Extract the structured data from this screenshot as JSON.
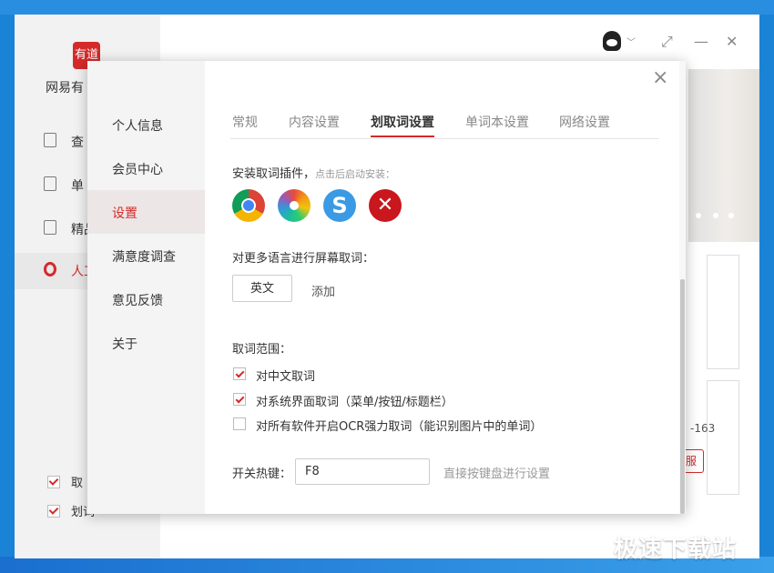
{
  "app": {
    "logo_text": "有道",
    "name": "网易有",
    "nav": [
      {
        "label": "查",
        "icon": "lookup-icon"
      },
      {
        "label": "单",
        "icon": "wordbook-icon"
      },
      {
        "label": "精品",
        "icon": "video-course-icon"
      },
      {
        "label": "人工",
        "icon": "human-translate-icon"
      }
    ],
    "bottom_checks": [
      {
        "label": "取",
        "checked": true
      },
      {
        "label": "划词",
        "checked": true
      }
    ],
    "window_controls": {
      "restore": "⤢",
      "minimize": "—",
      "close": "✕",
      "caret": "﹀"
    },
    "card_number": "-163",
    "card_button": "服"
  },
  "dialog": {
    "close_label": "×",
    "nav": [
      {
        "label": "个人信息",
        "active": false
      },
      {
        "label": "会员中心",
        "active": false
      },
      {
        "label": "设置",
        "active": true
      },
      {
        "label": "满意度调查",
        "active": false
      },
      {
        "label": "意见反馈",
        "active": false
      },
      {
        "label": "关于",
        "active": false
      }
    ],
    "tabs": [
      {
        "label": "常规",
        "active": false
      },
      {
        "label": "内容设置",
        "active": false
      },
      {
        "label": "划取词设置",
        "active": true
      },
      {
        "label": "单词本设置",
        "active": false
      },
      {
        "label": "网络设置",
        "active": false
      }
    ],
    "plugins": {
      "title": "安装取词插件，",
      "hint": "点击后启动安装：",
      "items": [
        {
          "name": "chrome-icon",
          "glyph": ""
        },
        {
          "name": "360-browser-icon",
          "glyph": ""
        },
        {
          "name": "sogou-browser-icon",
          "glyph": "S"
        },
        {
          "name": "adobe-acrobat-icon",
          "glyph": "✕"
        }
      ]
    },
    "languages": {
      "title": "对更多语言进行屏幕取词：",
      "button": "英文",
      "add": "添加"
    },
    "scope": {
      "title": "取词范围：",
      "options": [
        {
          "label": "对中文取词",
          "checked": true
        },
        {
          "label": "对系统界面取词（菜单/按钮/标题栏）",
          "checked": true
        },
        {
          "label": "对所有软件开启OCR强力取词（能识别图片中的单词）",
          "checked": false
        }
      ]
    },
    "hotkey": {
      "label": "开关热键：",
      "value": "F8",
      "hint": "直接按键盘进行设置"
    }
  },
  "watermark": "极速下载站"
}
